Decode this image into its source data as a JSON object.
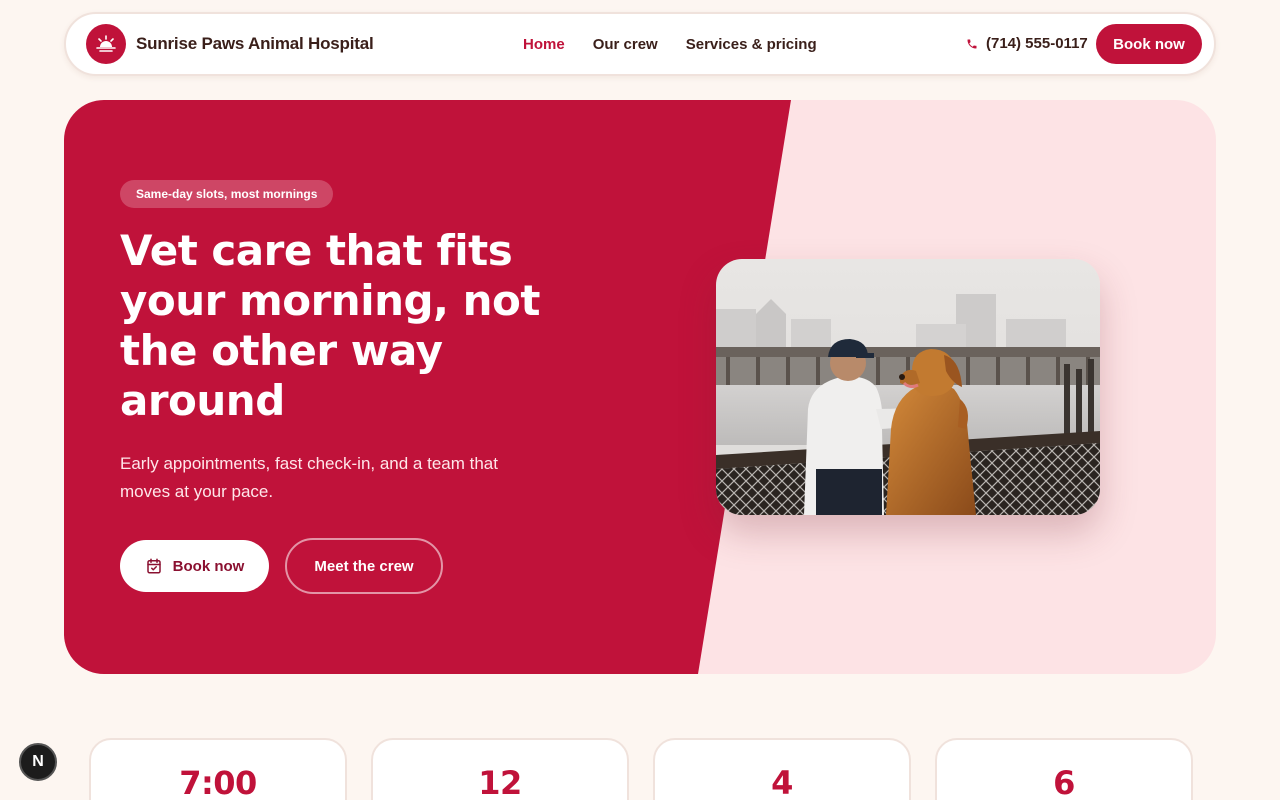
{
  "brand": {
    "name": "Sunrise Paws Animal Hospital",
    "logo_icon": "sunrise-icon",
    "accent_color": "#c0123a"
  },
  "nav": {
    "links": [
      {
        "label": "Home",
        "active": true
      },
      {
        "label": "Our crew",
        "active": false
      },
      {
        "label": "Services & pricing",
        "active": false
      }
    ],
    "phone": "(714) 555-0117",
    "phone_icon": "phone-icon",
    "book_label": "Book now"
  },
  "hero": {
    "badge": "Same-day slots, most mornings",
    "title": "Vet care that fits your morning, not the other way around",
    "subtitle": "Early appointments, fast check-in, and a team that moves at your pace.",
    "primary_button": {
      "label": "Book now",
      "icon": "calendar-check-icon"
    },
    "secondary_button": {
      "label": "Meet the crew"
    },
    "colors": {
      "red": "#c0123a",
      "pink": "#fde3e5"
    }
  },
  "stats": [
    {
      "value": "7:00"
    },
    {
      "value": "12"
    },
    {
      "value": "4"
    },
    {
      "value": "6"
    }
  ],
  "floating_badge": {
    "label": "N"
  }
}
